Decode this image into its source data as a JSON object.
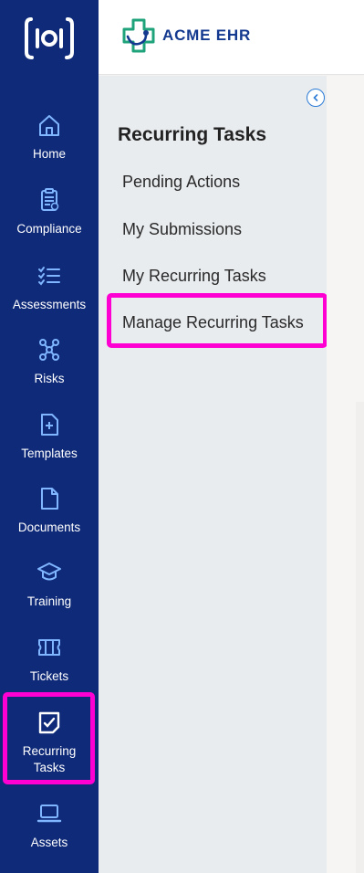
{
  "brand": {
    "name": "ACME EHR"
  },
  "rail": {
    "items": [
      {
        "label": "Home",
        "icon": "home-icon"
      },
      {
        "label": "Compliance",
        "icon": "compliance-icon"
      },
      {
        "label": "Assessments",
        "icon": "assessments-icon"
      },
      {
        "label": "Risks",
        "icon": "risks-icon"
      },
      {
        "label": "Templates",
        "icon": "templates-icon"
      },
      {
        "label": "Documents",
        "icon": "documents-icon"
      },
      {
        "label": "Training",
        "icon": "training-icon"
      },
      {
        "label": "Tickets",
        "icon": "tickets-icon"
      },
      {
        "label": "Recurring\nTasks",
        "icon": "recurring-tasks-icon",
        "selected": true
      },
      {
        "label": "Assets",
        "icon": "assets-icon"
      }
    ]
  },
  "subnav": {
    "title": "Recurring Tasks",
    "items": [
      {
        "label": "Pending Actions"
      },
      {
        "label": "My Submissions"
      },
      {
        "label": "My Recurring Tasks"
      },
      {
        "label": "Manage Recurring Tasks",
        "highlighted": true
      }
    ]
  },
  "colors": {
    "rail_bg": "#0f2a78",
    "highlight": "#ff00d2",
    "brand_blue": "#143a8f",
    "brand_green": "#1fa37a"
  }
}
